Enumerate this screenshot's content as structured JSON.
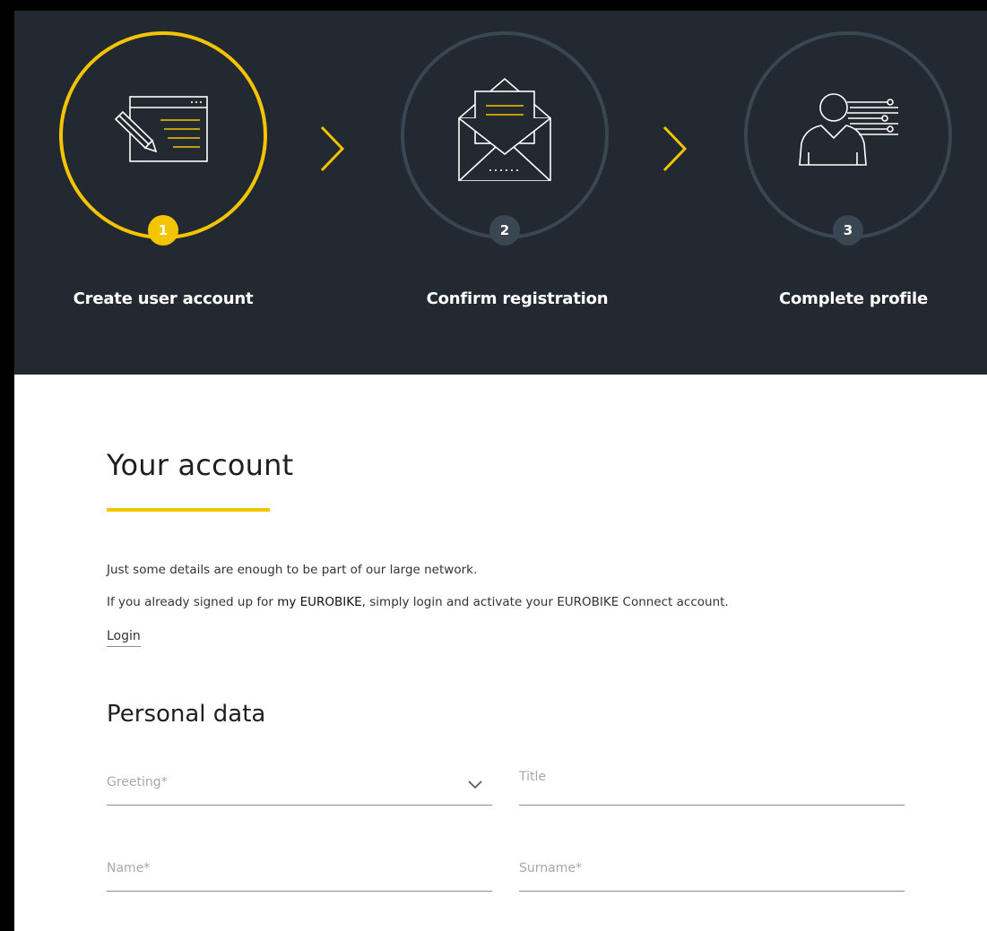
{
  "steps": [
    {
      "number": "1",
      "label": "Create user account",
      "active": true
    },
    {
      "number": "2",
      "label": "Confirm registration",
      "active": false
    },
    {
      "number": "3",
      "label": "Complete profile",
      "active": false
    }
  ],
  "colors": {
    "accent": "#f5c400",
    "hero_bg": "#222930",
    "inactive_ring": "#3a4652"
  },
  "account": {
    "heading": "Your account",
    "intro_line1": "Just some details are enough to be part of our large network.",
    "intro_line2_before": "If you already signed up for ",
    "intro_line2_brand": "my EUROBIKE",
    "intro_line2_after": ", simply login and activate your EUROBIKE Connect account.",
    "login_link": "Login"
  },
  "personal": {
    "heading": "Personal data",
    "greeting_placeholder": "Greeting*",
    "title_placeholder": "Title",
    "name_placeholder": "Name*",
    "surname_placeholder": "Surname*"
  },
  "icons": {
    "step1": "edit-form-icon",
    "step2": "open-envelope-icon",
    "step3": "user-profile-icon",
    "arrow": "chevron-right-icon",
    "select": "chevron-down-icon"
  }
}
